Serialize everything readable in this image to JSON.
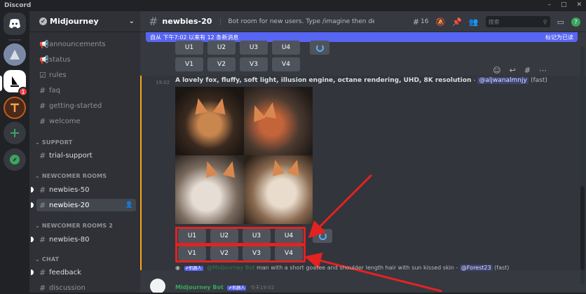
{
  "app": {
    "title": "Discord",
    "window_controls": [
      "–",
      "□",
      "✕"
    ]
  },
  "server_rail": {
    "badge_count": "1"
  },
  "sidebar": {
    "guild_name": "Midjourney",
    "channels_top": [
      "announcements",
      "status",
      "rules",
      "faq",
      "getting-started",
      "welcome"
    ],
    "cat_support": "SUPPORT",
    "support_channels": [
      "trial-support"
    ],
    "cat_newcomer": "NEWCOMER ROOMS",
    "newcomer_channels": [
      "newbies-50",
      "newbies-20"
    ],
    "cat_newcomer2": "NEWCOMER ROOMS 2",
    "newcomer2_channels": [
      "newbies-80"
    ],
    "cat_chat": "CHAT",
    "chat_channels": [
      "feedback",
      "discussion"
    ]
  },
  "topbar": {
    "channel_name": "newbies-20",
    "topic": "Bot room for new users. Type /imagine then describe what y...",
    "member_count": "16",
    "search_placeholder": "搜索"
  },
  "banner": {
    "text": "自从 下午7:02 以来有 12 条新消息",
    "action": "标记为已读"
  },
  "buttons_top": {
    "u": [
      "U1",
      "U2",
      "U3",
      "U4"
    ],
    "v": [
      "V1",
      "V2",
      "V3",
      "V4"
    ]
  },
  "message": {
    "time": "19:02",
    "prompt": "A lovely fox, fluffy, soft light, illusion engine, octane rendering, UHD, 8K resolution",
    "separator": " - ",
    "mention": "@aljwanalmnjy",
    "speed": "(fast)"
  },
  "buttons_main": {
    "u": [
      "U1",
      "U2",
      "U3",
      "U4"
    ],
    "v": [
      "V1",
      "V2",
      "V3",
      "V4"
    ]
  },
  "reply": {
    "tag": "✔机器人",
    "author": "@Midjourney Bot",
    "text": "man with a short goatee and shoulder length hair with sun kissed skin",
    "mention": "@Forest23",
    "speed": "(fast)"
  },
  "next_message": {
    "author": "Midjourney Bot",
    "tag": "✔机器人",
    "time": "今天19:02"
  },
  "colors": {
    "accent": "#5865f2",
    "highlight": "#faa61a",
    "annotation": "#e32222",
    "bot_name": "#3ba55c"
  }
}
